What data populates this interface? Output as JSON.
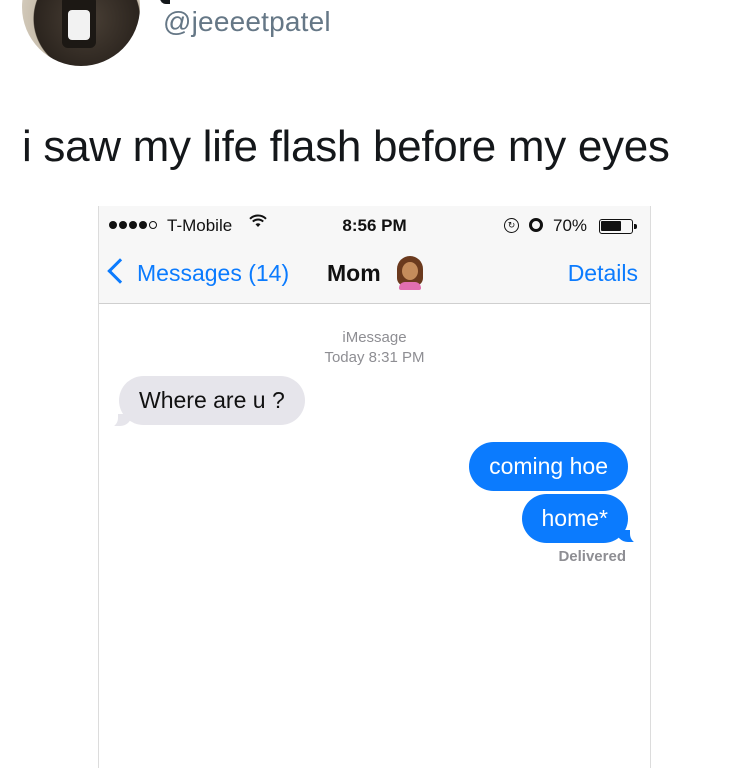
{
  "tweet": {
    "handle": "@jeeeetpatel",
    "text": "i saw my life flash before my eyes"
  },
  "phone": {
    "status_bar": {
      "carrier": "T-Mobile",
      "time": "8:56 PM",
      "battery": "70%",
      "battery_level": 0.7
    },
    "nav": {
      "back_label": "Messages (14)",
      "contact": "Mom",
      "details_label": "Details"
    },
    "conversation": {
      "service": "iMessage",
      "timestamp": "Today 8:31 PM",
      "messages": [
        {
          "direction": "incoming",
          "text": "Where are u ?"
        },
        {
          "direction": "outgoing",
          "text": "coming hoe"
        },
        {
          "direction": "outgoing",
          "text": "home*"
        }
      ],
      "status": "Delivered"
    },
    "colors": {
      "accent": "#0b7bfe",
      "incoming_bubble": "#e6e5eb",
      "outgoing_bubble": "#0b7bfe"
    }
  }
}
